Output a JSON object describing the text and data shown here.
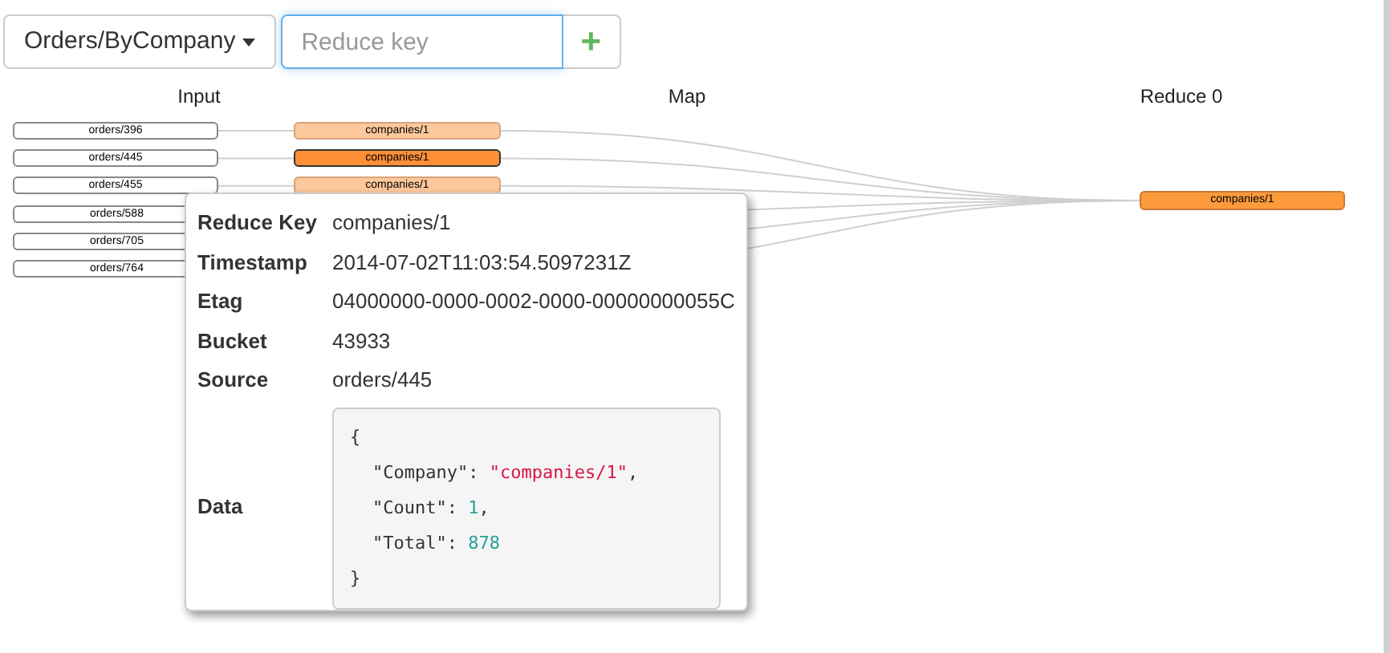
{
  "toolbar": {
    "index_dropdown": "Orders/ByCompany",
    "reduce_key": {
      "placeholder": "Reduce key"
    },
    "add_button": "+"
  },
  "columns": [
    "Input",
    "Map",
    "Reduce 0"
  ],
  "inputs": [
    {
      "label": "orders/396"
    },
    {
      "label": "orders/445"
    },
    {
      "label": "orders/455"
    },
    {
      "label": "orders/588"
    },
    {
      "label": "orders/705"
    },
    {
      "label": "orders/764"
    }
  ],
  "map": [
    {
      "label": "companies/1",
      "selected": false
    },
    {
      "label": "companies/1",
      "selected": true
    },
    {
      "label": "companies/1",
      "selected": false
    }
  ],
  "reduce": [
    {
      "label": "companies/1"
    }
  ],
  "popup": {
    "fields": [
      {
        "label": "Reduce Key",
        "value": "companies/1"
      },
      {
        "label": "Timestamp",
        "value": "2014-07-02T11:03:54.5097231Z"
      },
      {
        "label": "Etag",
        "value": "04000000-0000-0002-0000-00000000055C"
      },
      {
        "label": "Bucket",
        "value": "43933"
      },
      {
        "label": "Source",
        "value": "orders/445"
      }
    ],
    "data_label": "Data",
    "data": {
      "open": "{",
      "close": "}",
      "lines": [
        {
          "key": "\"Company\"",
          "colon": ":",
          "value": "\"companies/1\"",
          "kind": "string",
          "trail": ","
        },
        {
          "key": "\"Count\"",
          "colon": ":",
          "value": "1",
          "kind": "number",
          "trail": ","
        },
        {
          "key": "\"Total\"",
          "colon": ":",
          "value": "878",
          "kind": "number"
        }
      ]
    }
  }
}
